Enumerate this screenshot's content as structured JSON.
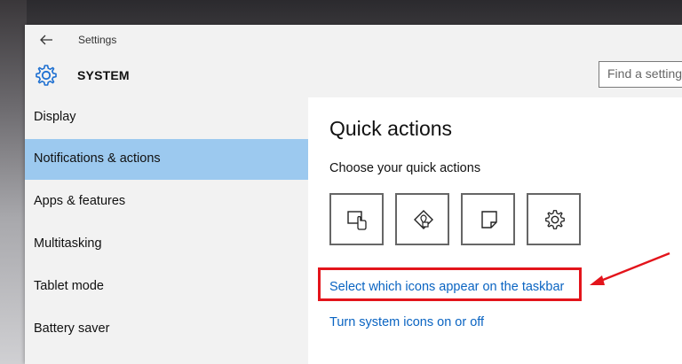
{
  "window": {
    "title": "Settings"
  },
  "header": {
    "section": "SYSTEM",
    "search_placeholder": "Find a setting"
  },
  "sidebar": {
    "items": [
      {
        "label": "Display",
        "selected": false
      },
      {
        "label": "Notifications & actions",
        "selected": true
      },
      {
        "label": "Apps & features",
        "selected": false
      },
      {
        "label": "Multitasking",
        "selected": false
      },
      {
        "label": "Tablet mode",
        "selected": false
      },
      {
        "label": "Battery saver",
        "selected": false
      }
    ]
  },
  "main": {
    "title": "Quick actions",
    "subtitle": "Choose your quick actions",
    "quick_action_tiles": [
      {
        "icon": "tablet-mode-icon"
      },
      {
        "icon": "location-icon"
      },
      {
        "icon": "note-icon"
      },
      {
        "icon": "all-settings-gear-icon"
      }
    ],
    "links": [
      {
        "label": "Select which icons appear on the taskbar"
      },
      {
        "label": "Turn system icons on or off"
      }
    ]
  },
  "annotation": {
    "highlight_color": "#e3141b"
  },
  "colors": {
    "selected_nav": "#9cc9ef",
    "link": "#0a64c2",
    "accent_icon": "#1d6fd1"
  }
}
